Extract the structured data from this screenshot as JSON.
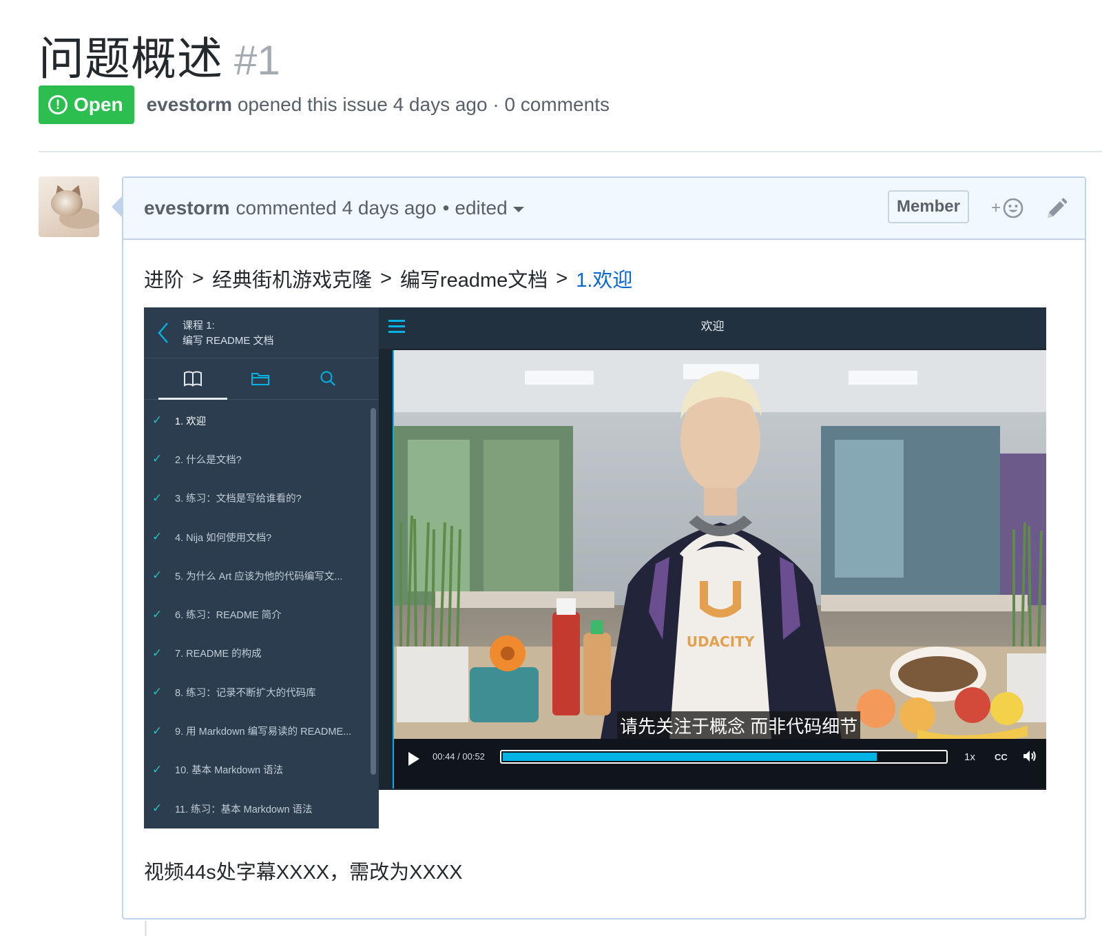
{
  "issue": {
    "title": "问题概述",
    "number": "#1",
    "state": "Open",
    "author": "evestorm",
    "meta_suffix": "opened this issue 4 days ago · 0 comments"
  },
  "comment": {
    "author": "evestorm",
    "action": "commented 4 days ago",
    "bullet": "•",
    "edited": "edited",
    "role_badge": "Member",
    "react_plus": "+",
    "breadcrumb": {
      "parts": [
        "进阶",
        "经典街机游戏克隆",
        "编写readme文档"
      ],
      "sep": ">",
      "link": "1.欢迎"
    },
    "note": "视频44s处字幕XXXX，需改为XXXX"
  },
  "lesson_player": {
    "lesson_title_line1": "课程 1:",
    "lesson_title_line2": "编写 README 文档",
    "tabs": [
      "book-icon",
      "folder-icon",
      "search-icon"
    ],
    "check": "✓",
    "items": [
      "1. 欢迎",
      "2. 什么是文档?",
      "3. 练习：文档是写给谁看的?",
      "4. Nija 如何使用文档?",
      "5. 为什么 Art 应该为他的代码编写文...",
      "6. 练习：README 简介",
      "7. README 的构成",
      "8. 练习：记录不断扩大的代码库",
      "9. 用 Markdown 编写易读的 README...",
      "10. 基本 Markdown 语法",
      "11. 练习：基本 Markdown 语法"
    ],
    "video_title": "欢迎",
    "subtitle": "请先关注于概念 而非代码细节",
    "apron_letter": "U",
    "apron_brand": "UDACITY",
    "time": "00:44 / 00:52",
    "progress": 0.846,
    "speed": "1x",
    "cc": "CC",
    "accent": "#02b3e4"
  }
}
